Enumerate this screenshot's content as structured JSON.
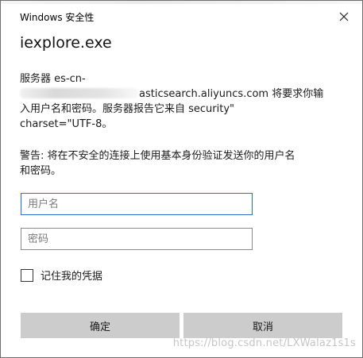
{
  "window": {
    "title": "Windows 安全性",
    "app_name": "iexplore.exe"
  },
  "message": {
    "line1": "服务器 es-cn-",
    "line2_suffix": "asticsearch.aliyuncs.com 将要求你输",
    "line3": "入用户名和密码。服务器报告它来自 security\"",
    "line4": "charset=\"UTF-8。"
  },
  "warning": {
    "line1": "警告: 将在不安全的连接上使用基本身份验证发送你的用户名",
    "line2": "和密码。"
  },
  "form": {
    "username_placeholder": "用户名",
    "username_value": "",
    "password_placeholder": "密码",
    "password_value": "",
    "remember_label": "记住我的凭据",
    "remember_checked": false
  },
  "buttons": {
    "ok_label": "确定",
    "cancel_label": "取消"
  },
  "watermark": "https://blog.csdn.net/LXWalaz1s1s",
  "colors": {
    "focus_border": "#2a6fc9",
    "button_bg": "#cccccc"
  },
  "icons": {
    "close": "close-icon"
  }
}
